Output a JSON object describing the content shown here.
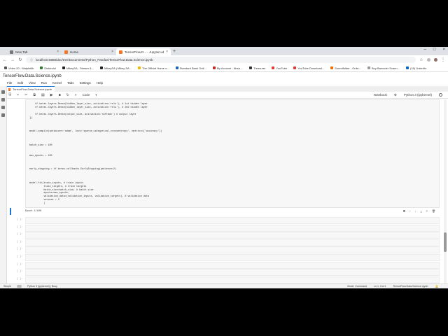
{
  "browser": {
    "tabs": [
      {
        "label": "New Tab",
        "active": false
      },
      {
        "label": "Home",
        "active": false
      },
      {
        "label": "TensorFlow.D... - JupyterLab",
        "active": true
      }
    ],
    "new_tab_symbol": "+",
    "address": "localhost:8888/doc/tree/Documents/Python_Pandas/TensorFlow.Data.Science.ipynb",
    "bookmarks": [
      {
        "label": "Video 20 - Matplotlib",
        "color": "#555"
      },
      {
        "label": "Disbindol",
        "color": "#2e7d32"
      },
      {
        "label": "MikeySA - Stream &...",
        "color": "#222"
      },
      {
        "label": "MikeySA | Mikey SA...",
        "color": "#222"
      },
      {
        "label": "The Official Home o...",
        "color": "#f5b800"
      },
      {
        "label": "Standard Bank Onli...",
        "color": "#1565c0"
      },
      {
        "label": "My Account - Absa ...",
        "color": "#c62828"
      },
      {
        "label": "Treasurer",
        "color": "#333"
      },
      {
        "label": "YouTube",
        "color": "#e53935"
      },
      {
        "label": "YouTube Download...",
        "color": "#e53935"
      },
      {
        "label": "Soundfolder - Onlin...",
        "color": "#ef6c00"
      },
      {
        "label": "Buy Barcoder Scann...",
        "color": "#999"
      },
      {
        "label": "(18) LinkedIn",
        "color": "#0a66c2"
      }
    ]
  },
  "jupyter": {
    "title": "TensorFlow.Data.Science.ipynb",
    "menu": [
      "File",
      "Edit",
      "View",
      "Run",
      "Kernel",
      "Tabs",
      "Settings",
      "Help"
    ],
    "notebook_tab": "TensorFlow.Data.Science.ipynb",
    "toolbar_mode": "Code",
    "toolbar_right": {
      "notebook": "Notebook",
      "kernel": "Python 3 (ipykernel)"
    }
  },
  "code_lines": [
    "    tf.keras.layers.Dense(hidden_layer_size, activation='relu'), # 1st hidden layer",
    "    tf.keras.layers.Dense(hidden_layer_size, activation='relu'), # 2nd hidden layer",
    "",
    "    tf.keras.layers.Dense(output_size, activation='softmax') # output layer",
    "])",
    "",
    "",
    "",
    "model.compile(optimizer='adam', loss='sparse_categorical_crossentropy', metrics=['accuracy'])",
    "",
    "",
    "",
    "batch_size = 100",
    "",
    "",
    "max_epochs = 100",
    "",
    "",
    "",
    "early_stopping = tf.keras.callbacks.EarlyStopping(patience=2)",
    "",
    "",
    "",
    "model.fit(train_inputs, # train inputs",
    "          train_targets, # train targets",
    "          batch_size=batch_size, # batch size",
    "          epochs=max_epochs,",
    "          validation_data=(validation_inputs, validation_targets), # validation data",
    "          verbose = 2",
    "          )"
  ],
  "output": "Epoch 1/100",
  "empty_cell_prompt": "[ ]:",
  "status": {
    "mode_left": "Simple",
    "kernel": "Python 3 (ipykernel) | Busy",
    "mode": "Mode: Command",
    "position": "Ln 1, Col 1",
    "file": "TensorFlow.Data.Science.ipynb"
  }
}
